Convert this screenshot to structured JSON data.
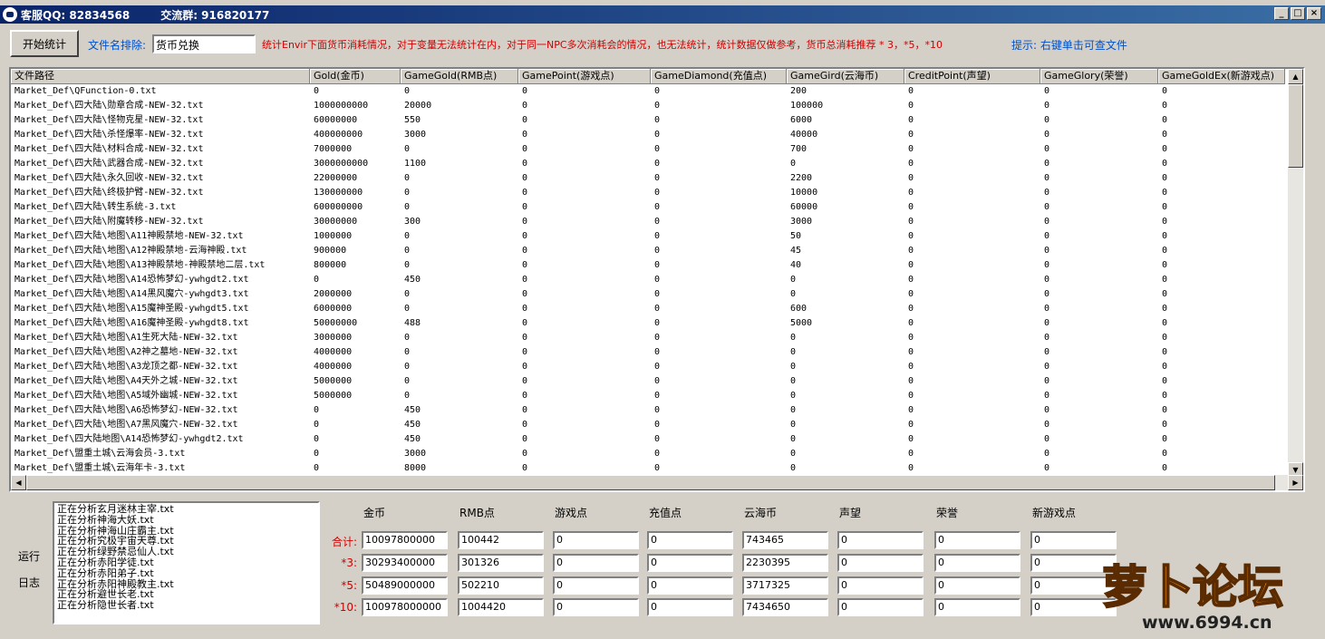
{
  "titlebar": {
    "qq": "客服QQ: 82834568",
    "group": "交流群: 916820177"
  },
  "toolbar": {
    "start_label": "开始统计",
    "exclude_label": "文件名排除:",
    "exclude_value": "货币兑换",
    "notice": "统计Envir下面货币消耗情况，对于变量无法统计在内，对于同一NPC多次消耗会的情况，也无法统计，统计数据仅做参考，货币总消耗推荐 * 3，*5，*10",
    "tip": "提示: 右键单击可查文件"
  },
  "grid": {
    "columns": [
      "文件路径",
      "Gold(金币)",
      "GameGold(RMB点)",
      "GamePoint(游戏点)",
      "GameDiamond(充值点)",
      "GameGird(云海币)",
      "CreditPoint(声望)",
      "GameGlory(荣誉)",
      "GameGoldEx(新游戏点)"
    ],
    "rows": [
      [
        "Market_Def\\QFunction-0.txt",
        "0",
        "0",
        "0",
        "0",
        "200",
        "0",
        "0",
        "0"
      ],
      [
        "Market_Def\\四大陆\\勋章合成-NEW-32.txt",
        "1000000000",
        "20000",
        "0",
        "0",
        "100000",
        "0",
        "0",
        "0"
      ],
      [
        "Market_Def\\四大陆\\怪物克星-NEW-32.txt",
        "60000000",
        "550",
        "0",
        "0",
        "6000",
        "0",
        "0",
        "0"
      ],
      [
        "Market_Def\\四大陆\\杀怪爆率-NEW-32.txt",
        "400000000",
        "3000",
        "0",
        "0",
        "40000",
        "0",
        "0",
        "0"
      ],
      [
        "Market_Def\\四大陆\\材料合成-NEW-32.txt",
        "7000000",
        "0",
        "0",
        "0",
        "700",
        "0",
        "0",
        "0"
      ],
      [
        "Market_Def\\四大陆\\武器合成-NEW-32.txt",
        "3000000000",
        "1100",
        "0",
        "0",
        "0",
        "0",
        "0",
        "0"
      ],
      [
        "Market_Def\\四大陆\\永久回收-NEW-32.txt",
        "22000000",
        "0",
        "0",
        "0",
        "2200",
        "0",
        "0",
        "0"
      ],
      [
        "Market_Def\\四大陆\\终极护臂-NEW-32.txt",
        "130000000",
        "0",
        "0",
        "0",
        "10000",
        "0",
        "0",
        "0"
      ],
      [
        "Market_Def\\四大陆\\转生系统-3.txt",
        "600000000",
        "0",
        "0",
        "0",
        "60000",
        "0",
        "0",
        "0"
      ],
      [
        "Market_Def\\四大陆\\附魔转移-NEW-32.txt",
        "30000000",
        "300",
        "0",
        "0",
        "3000",
        "0",
        "0",
        "0"
      ],
      [
        "Market_Def\\四大陆\\地图\\A11神殿禁地-NEW-32.txt",
        "1000000",
        "0",
        "0",
        "0",
        "50",
        "0",
        "0",
        "0"
      ],
      [
        "Market_Def\\四大陆\\地图\\A12神殿禁地-云海神殿.txt",
        "900000",
        "0",
        "0",
        "0",
        "45",
        "0",
        "0",
        "0"
      ],
      [
        "Market_Def\\四大陆\\地图\\A13神殿禁地-神殿禁地二层.txt",
        "800000",
        "0",
        "0",
        "0",
        "40",
        "0",
        "0",
        "0"
      ],
      [
        "Market_Def\\四大陆\\地图\\A14恐怖梦幻-ywhgdt2.txt",
        "0",
        "450",
        "0",
        "0",
        "0",
        "0",
        "0",
        "0"
      ],
      [
        "Market_Def\\四大陆\\地图\\A14黑风魔穴-ywhgdt3.txt",
        "2000000",
        "0",
        "0",
        "0",
        "0",
        "0",
        "0",
        "0"
      ],
      [
        "Market_Def\\四大陆\\地图\\A15魔神圣殿-ywhgdt5.txt",
        "6000000",
        "0",
        "0",
        "0",
        "600",
        "0",
        "0",
        "0"
      ],
      [
        "Market_Def\\四大陆\\地图\\A16魔神圣殿-ywhgdt8.txt",
        "50000000",
        "488",
        "0",
        "0",
        "5000",
        "0",
        "0",
        "0"
      ],
      [
        "Market_Def\\四大陆\\地图\\A1生死大陆-NEW-32.txt",
        "3000000",
        "0",
        "0",
        "0",
        "0",
        "0",
        "0",
        "0"
      ],
      [
        "Market_Def\\四大陆\\地图\\A2神之墓地-NEW-32.txt",
        "4000000",
        "0",
        "0",
        "0",
        "0",
        "0",
        "0",
        "0"
      ],
      [
        "Market_Def\\四大陆\\地图\\A3龙顶之都-NEW-32.txt",
        "4000000",
        "0",
        "0",
        "0",
        "0",
        "0",
        "0",
        "0"
      ],
      [
        "Market_Def\\四大陆\\地图\\A4天外之城-NEW-32.txt",
        "5000000",
        "0",
        "0",
        "0",
        "0",
        "0",
        "0",
        "0"
      ],
      [
        "Market_Def\\四大陆\\地图\\A5域外幽城-NEW-32.txt",
        "5000000",
        "0",
        "0",
        "0",
        "0",
        "0",
        "0",
        "0"
      ],
      [
        "Market_Def\\四大陆\\地图\\A6恐怖梦幻-NEW-32.txt",
        "0",
        "450",
        "0",
        "0",
        "0",
        "0",
        "0",
        "0"
      ],
      [
        "Market_Def\\四大陆\\地图\\A7黑风魔穴-NEW-32.txt",
        "0",
        "450",
        "0",
        "0",
        "0",
        "0",
        "0",
        "0"
      ],
      [
        "Market_Def\\四大陆地图\\A14恐怖梦幻-ywhgdt2.txt",
        "0",
        "450",
        "0",
        "0",
        "0",
        "0",
        "0",
        "0"
      ],
      [
        "Market_Def\\盟重土城\\云海会员-3.txt",
        "0",
        "3000",
        "0",
        "0",
        "0",
        "0",
        "0",
        "0"
      ],
      [
        "Market_Def\\盟重土城\\云海年卡-3.txt",
        "0",
        "8000",
        "0",
        "0",
        "0",
        "0",
        "0",
        "0"
      ]
    ]
  },
  "log": {
    "label_1": "运行",
    "label_2": "日志",
    "lines": [
      "正在分析玄月迷林主宰.txt",
      "正在分析神海大妖.txt",
      "正在分析神海山庄霸主.txt",
      "正在分析究极宇宙天尊.txt",
      "正在分析绿野禁忌仙人.txt",
      "正在分析赤阳学徒.txt",
      "正在分析赤阳弟子.txt",
      "正在分析赤阳神殿教主.txt",
      "正在分析避世长老.txt",
      "正在分析隐世长者.txt"
    ]
  },
  "summary": {
    "headers": [
      "金币",
      "RMB点",
      "游戏点",
      "充值点",
      "云海币",
      "声望",
      "荣誉",
      "新游戏点"
    ],
    "rows": [
      {
        "label": "合计:",
        "values": [
          "10097800000",
          "100442",
          "0",
          "0",
          "743465",
          "0",
          "0",
          "0"
        ]
      },
      {
        "label": "*3:",
        "values": [
          "30293400000",
          "301326",
          "0",
          "0",
          "2230395",
          "0",
          "0",
          "0"
        ]
      },
      {
        "label": "*5:",
        "values": [
          "50489000000",
          "502210",
          "0",
          "0",
          "3717325",
          "0",
          "0",
          "0"
        ]
      },
      {
        "label": "*10:",
        "values": [
          "100978000000",
          "1004420",
          "0",
          "0",
          "7434650",
          "0",
          "0",
          "0"
        ]
      }
    ]
  },
  "watermark": {
    "text": "萝卜论坛",
    "url": "www.6994.cn"
  },
  "colors": {
    "title_bg": "#0a246a",
    "notice": "#d00000",
    "tip": "#0050c8",
    "accent_orange": "#f08c00"
  }
}
